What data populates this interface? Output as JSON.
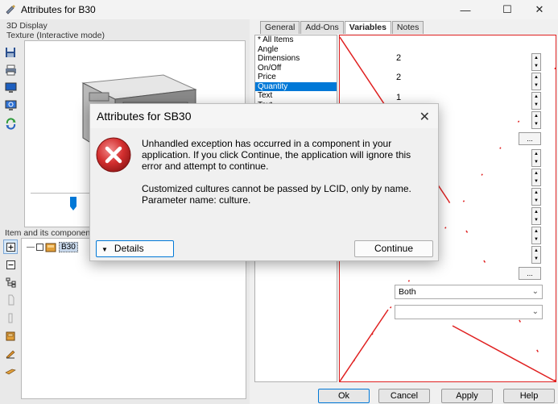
{
  "window": {
    "title": "Attributes for B30",
    "controls": [
      "minimize-icon",
      "maximize-icon",
      "close-icon"
    ]
  },
  "left_panel": {
    "display_label": "3D Display",
    "texture_label": "Texture (Interactive mode)",
    "tree_label": "Item and its components",
    "tree_item": "B30",
    "toolbar_icons": [
      "save-icon",
      "print-icon",
      "monitor-icon",
      "monitor-refresh-icon",
      "rotate-icon"
    ],
    "tree_icons": [
      "expand-icon",
      "collapse-icon",
      "hierarchy-icon",
      "copy-icon",
      "paste-icon",
      "cabinet-icon",
      "pencil-icon",
      "flat-part-icon"
    ]
  },
  "right_panel": {
    "tabs": [
      "General",
      "Add-Ons",
      "Variables",
      "Notes"
    ],
    "active_tab": "Variables",
    "categories": [
      "* All Items",
      "Angle",
      "Dimensions",
      "On/Off",
      "Price",
      "Quantity",
      "Text",
      "Text"
    ],
    "selected_category": "Quantity",
    "values": [
      "2",
      "2",
      "1"
    ],
    "dropdown_value": "Both",
    "ellipsis_label": "..."
  },
  "bottom_buttons": {
    "ok": "Ok",
    "cancel": "Cancel",
    "apply": "Apply",
    "help": "Help"
  },
  "dialog": {
    "title": "Attributes for SB30",
    "message_1": "Unhandled exception has occurred in a component in your application. If you click Continue, the application will ignore this error and attempt to continue.",
    "message_2": "Customized cultures cannot be passed by LCID, only by name.",
    "message_3": "Parameter name: culture.",
    "details_label": "Details",
    "continue_label": "Continue"
  },
  "colors": {
    "accent": "#0078d7",
    "error_red": "#c62828",
    "highlight_border": "#e02020"
  }
}
